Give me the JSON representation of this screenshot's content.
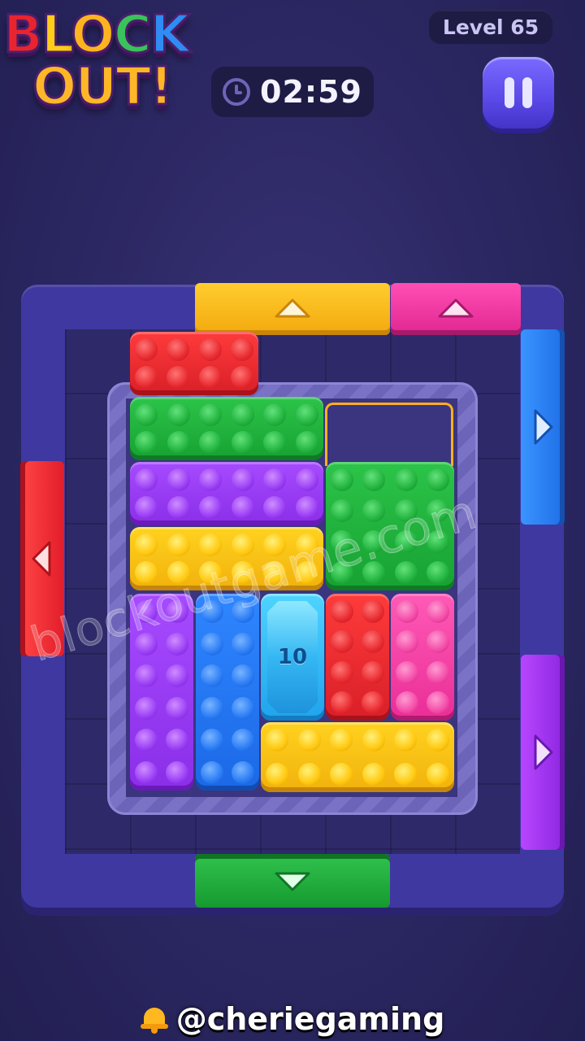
{
  "header": {
    "logo": {
      "line1": [
        "B",
        "L",
        "O",
        "C",
        "K"
      ],
      "line2": "OUT!"
    },
    "level_label": "Level 65",
    "timer": "02:59"
  },
  "board": {
    "gem_block": {
      "count": "10"
    }
  },
  "watermark": "blockoutgame.com",
  "footer": {
    "handle": "@cheriegaming"
  },
  "colors": {
    "red": "#e8242f",
    "green": "#1fb03c",
    "purple": "#9a3cf4",
    "yellow": "#ffc614",
    "blue": "#2577f2",
    "pink": "#f03aa3",
    "cyan": "#33b8f3"
  }
}
